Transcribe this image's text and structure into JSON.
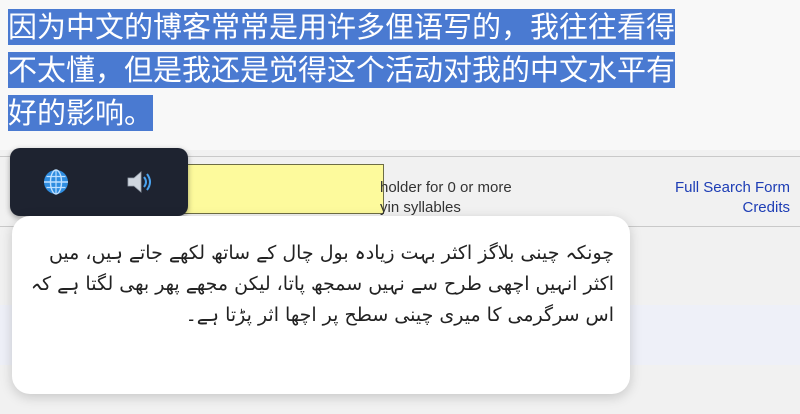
{
  "passage": {
    "lines": [
      "因为中文的博客常常是用许多俚语写的，我往往看得",
      "不太懂，但是我还是觉得这个活动对我的中文水平有",
      "好的影响。"
    ]
  },
  "page": {
    "hint_line1": "holder for 0 or more",
    "hint_line2": "yin syllables",
    "link_full_search": "Full Search Form",
    "link_credits": "Credits"
  },
  "toolbar": {
    "globe_icon": "globe-icon",
    "speaker_icon": "speaker-icon"
  },
  "translation": {
    "text": "چونکہ چینی بلاگز اکثر بہت زیادہ بول چال کے ساتھ لکھے جاتے ہیں، میں اکثر انہیں اچھی طرح سے نہیں سمجھ پاتا، لیکن مجھے پھر بھی لگتا ہے کہ اس سرگرمی کا میری چینی سطح پر اچھا اثر پڑتا ہے۔"
  },
  "colors": {
    "selection": "#4a7ad1",
    "toolbar_bg": "#1e2330",
    "search_box": "#fdfa9c",
    "link": "#1d3db5"
  }
}
